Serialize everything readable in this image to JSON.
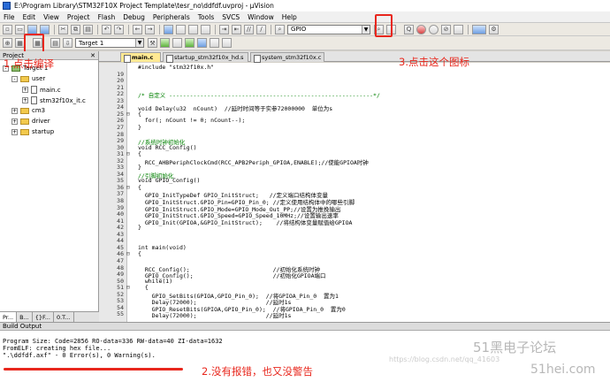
{
  "window": {
    "title": "E:\\Program Library\\STM32F10X Project Template\\tesr_no\\ddfdf.uvproj - µVision"
  },
  "menu": [
    "File",
    "Edit",
    "View",
    "Project",
    "Flash",
    "Debug",
    "Peripherals",
    "Tools",
    "SVCS",
    "Window",
    "Help"
  ],
  "toolbar": {
    "search_value": "GPIO",
    "target": "Target 1"
  },
  "project": {
    "title": "Project",
    "tree": [
      {
        "label": "Target 1",
        "kind": "target",
        "expander": "-"
      },
      {
        "label": "user",
        "kind": "folder",
        "expander": "-"
      },
      {
        "label": "main.c",
        "kind": "file",
        "expander": "+"
      },
      {
        "label": "stm32f10x_it.c",
        "kind": "file",
        "expander": "+"
      },
      {
        "label": "cm3",
        "kind": "folder",
        "expander": "+"
      },
      {
        "label": "driver",
        "kind": "folder",
        "expander": "+"
      },
      {
        "label": "startup",
        "kind": "folder",
        "expander": "+"
      }
    ],
    "tabs": [
      "Pr...",
      "B...",
      "{}F...",
      "0.T..."
    ]
  },
  "editor": {
    "tabs": [
      {
        "label": "main.c",
        "active": true
      },
      {
        "label": "startup_stm32f10x_hd.s",
        "active": false
      },
      {
        "label": "system_stm32f10x.c",
        "active": false
      }
    ],
    "lines": [
      {
        "n": "",
        "text": "#include \"stm32f10x.h\"",
        "cls": ""
      },
      {
        "n": "19",
        "text": "",
        "cls": ""
      },
      {
        "n": "20",
        "text": "",
        "cls": ""
      },
      {
        "n": "21",
        "text": "",
        "cls": ""
      },
      {
        "n": "22",
        "text": "/* 自定义 -----------------------------------------------------------*/",
        "cls": "cm"
      },
      {
        "n": "23",
        "text": "",
        "cls": ""
      },
      {
        "n": "24",
        "text": "void Delay(u32  nCount)  //延时时间等于实参72000000  单位为s",
        "cls": ""
      },
      {
        "n": "25",
        "text": "{",
        "cls": ""
      },
      {
        "n": "26",
        "text": "  for(; nCount != 0; nCount--);",
        "cls": ""
      },
      {
        "n": "27",
        "text": "}",
        "cls": ""
      },
      {
        "n": "28",
        "text": "",
        "cls": ""
      },
      {
        "n": "29",
        "text": "//系统时钟初始化",
        "cls": "cm"
      },
      {
        "n": "30",
        "text": "void RCC_Config()",
        "cls": ""
      },
      {
        "n": "31",
        "text": "{",
        "cls": ""
      },
      {
        "n": "32",
        "text": "  RCC_AHBPeriphClockCmd(RCC_APB2Periph_GPIOA,ENABLE);//使能GPIOA时钟",
        "cls": ""
      },
      {
        "n": "33",
        "text": "}",
        "cls": ""
      },
      {
        "n": "34",
        "text": "//引脚初始化",
        "cls": "cm"
      },
      {
        "n": "35",
        "text": "void GPIO_Config()",
        "cls": ""
      },
      {
        "n": "36",
        "text": "{",
        "cls": ""
      },
      {
        "n": "37",
        "text": "  GPIO_InitTypeDef GPIO_InitStruct;   //定义端口结构体变量",
        "cls": ""
      },
      {
        "n": "38",
        "text": "  GPIO_InitStruct.GPIO_Pin=GPIO_Pin_0; //定义使用结构体中的哪些引脚",
        "cls": ""
      },
      {
        "n": "39",
        "text": "  GPIO_InitStruct.GPIO_Mode=GPIO_Mode_Out_PP;//设置为推挽输出",
        "cls": ""
      },
      {
        "n": "40",
        "text": "  GPIO_InitStruct.GPIO_Speed=GPIO_Speed_10MHz;//设置输出速率",
        "cls": ""
      },
      {
        "n": "41",
        "text": "  GPIO_Init(GPIOA,&GPIO_InitStruct);    //将结构体变量赋值给GPIOA",
        "cls": ""
      },
      {
        "n": "42",
        "text": "}",
        "cls": ""
      },
      {
        "n": "43",
        "text": "",
        "cls": ""
      },
      {
        "n": "44",
        "text": "",
        "cls": ""
      },
      {
        "n": "45",
        "text": "int main(void)",
        "cls": ""
      },
      {
        "n": "46",
        "text": "{",
        "cls": ""
      },
      {
        "n": "47",
        "text": "",
        "cls": ""
      },
      {
        "n": "48",
        "text": "  RCC_Config();                        //初始化系统时钟",
        "cls": ""
      },
      {
        "n": "49",
        "text": "  GPIO_Config();                       //初始化GPIOA端口",
        "cls": ""
      },
      {
        "n": "50",
        "text": "  while(1)",
        "cls": ""
      },
      {
        "n": "51",
        "text": "  {",
        "cls": ""
      },
      {
        "n": "52",
        "text": "    GPIO_SetBits(GPIOA,GPIO_Pin_0);  //将GPIOA_Pin_0  置为1",
        "cls": ""
      },
      {
        "n": "53",
        "text": "    Delay(72000);                    //延时1s",
        "cls": ""
      },
      {
        "n": "54",
        "text": "    GPIO_ResetBits(GPIOA,GPIO_Pin_0);  //将GPIOA_Pin_0  置为0",
        "cls": ""
      },
      {
        "n": "55",
        "text": "    Delay(72000);                    //延时1s",
        "cls": ""
      }
    ]
  },
  "build": {
    "title": "Build Output",
    "lines": [
      "Program Size: Code=2856 RO-data=336 RW-data=40 ZI-data=1632",
      "FromELF: creating hex file...",
      "\".\\ddfdf.axf\" - 0 Error(s), 0 Warning(s)."
    ]
  },
  "annotations": {
    "step1": "1.点击编译",
    "step2": "2.没有报错，也又没警告",
    "step3": "3.点击这个图标"
  },
  "watermark": {
    "main": "51黑电子论坛",
    "site": "51hei.com",
    "blog": "https://blog.csdn.net/qq_41603"
  },
  "colors": {
    "annotation": "#e8271d",
    "active_tab": "#ffe993",
    "comment": "#008000"
  }
}
